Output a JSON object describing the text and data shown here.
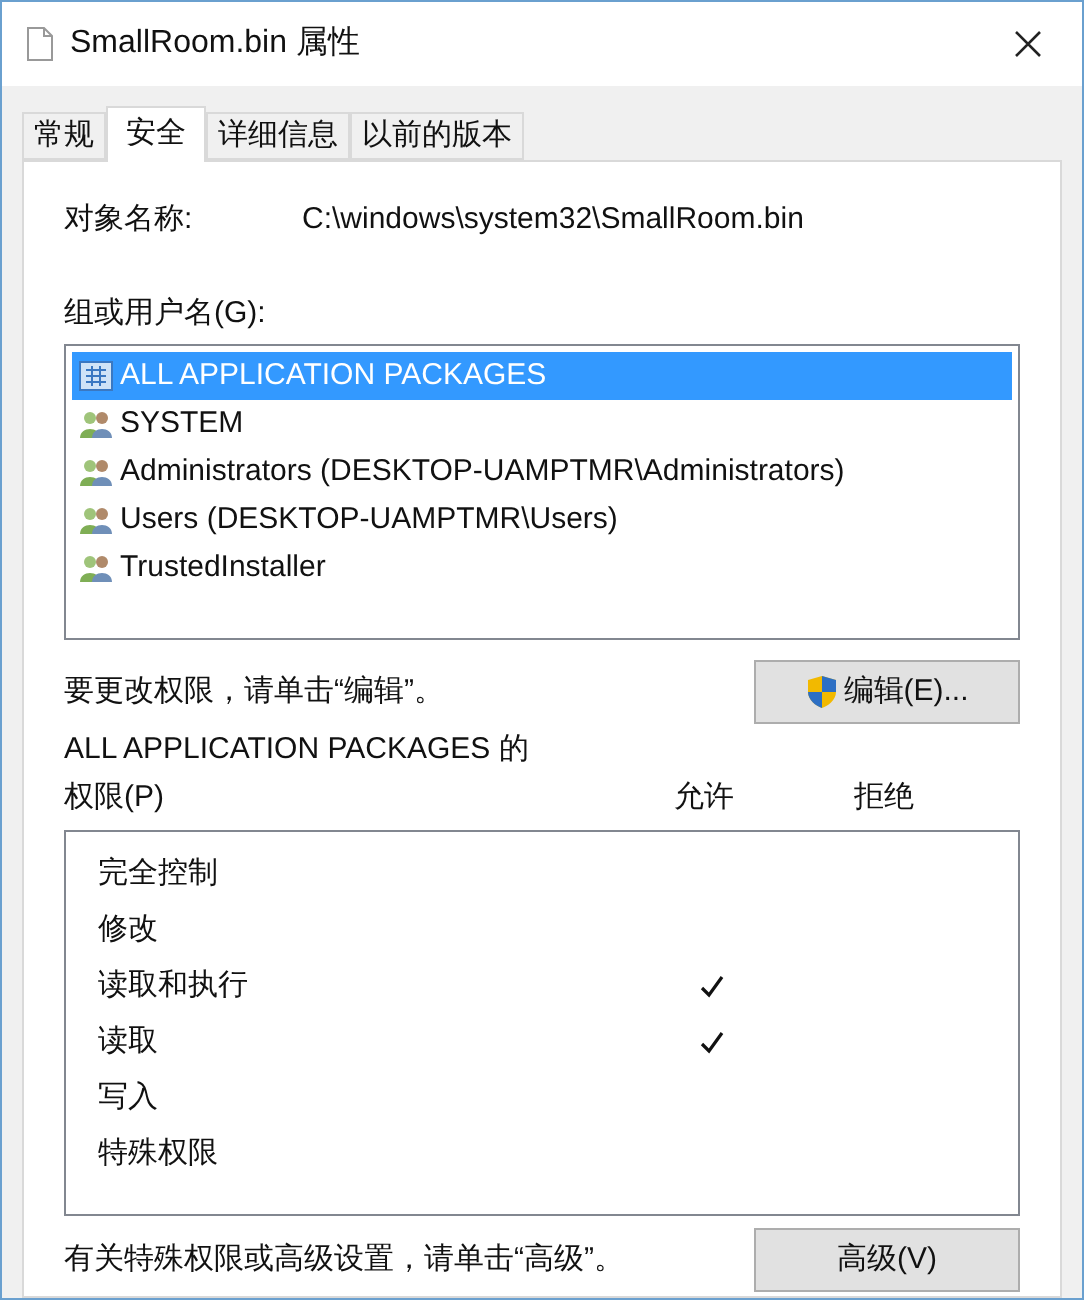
{
  "window": {
    "title": "SmallRoom.bin 属性"
  },
  "tabs": [
    {
      "label": "常规",
      "selected": false
    },
    {
      "label": "安全",
      "selected": true
    },
    {
      "label": "详细信息",
      "selected": false
    },
    {
      "label": "以前的版本",
      "selected": false
    }
  ],
  "object_name": {
    "label": "对象名称:",
    "value": "C:\\windows\\system32\\SmallRoom.bin"
  },
  "groups": {
    "label": "组或用户名(G):",
    "items": [
      {
        "name": "ALL APPLICATION PACKAGES",
        "kind": "package",
        "selected": true
      },
      {
        "name": "SYSTEM",
        "kind": "users",
        "selected": false
      },
      {
        "name": "Administrators (DESKTOP-UAMPTMR\\Administrators)",
        "kind": "users",
        "selected": false
      },
      {
        "name": "Users (DESKTOP-UAMPTMR\\Users)",
        "kind": "users",
        "selected": false
      },
      {
        "name": "TrustedInstaller",
        "kind": "users",
        "selected": false
      }
    ]
  },
  "edit_hint": "要更改权限，请单击“编辑”。",
  "edit_button": "编辑(E)...",
  "permissions": {
    "title": "ALL APPLICATION PACKAGES 的",
    "label": "权限(P)",
    "allow_header": "允许",
    "deny_header": "拒绝",
    "rows": [
      {
        "name": "完全控制",
        "allow": false,
        "deny": false
      },
      {
        "name": "修改",
        "allow": false,
        "deny": false
      },
      {
        "name": "读取和执行",
        "allow": true,
        "deny": false
      },
      {
        "name": "读取",
        "allow": true,
        "deny": false
      },
      {
        "name": "写入",
        "allow": false,
        "deny": false
      },
      {
        "name": "特殊权限",
        "allow": false,
        "deny": false
      }
    ]
  },
  "advanced_hint": "有关特殊权限或高级设置，请单击“高级”。",
  "advanced_button": "高级(V)"
}
